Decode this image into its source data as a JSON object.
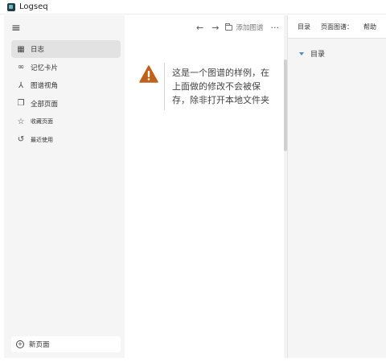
{
  "window": {
    "title": "Logseq"
  },
  "sidebar": {
    "menu_icon": "≡",
    "items": [
      {
        "icon": "calendar-icon",
        "glyph": "▦",
        "label": "日志",
        "active": true
      },
      {
        "icon": "flashcards-icon",
        "glyph": "∞",
        "label": "记忆卡片",
        "active": false
      },
      {
        "icon": "graph-icon",
        "glyph": "⅄",
        "label": "图谱视角",
        "active": false
      },
      {
        "icon": "pages-icon",
        "glyph": "❐",
        "label": "全部页面",
        "active": false
      },
      {
        "icon": "star-icon",
        "glyph": "☆",
        "label": "收藏页面",
        "active": false
      },
      {
        "icon": "history-icon",
        "glyph": "↺",
        "label": "最近使用",
        "active": false
      }
    ],
    "new_page_label": "新页面"
  },
  "toolbar": {
    "back_glyph": "←",
    "forward_glyph": "→",
    "add_graph_label": "添加图谱",
    "more_glyph": "···"
  },
  "main": {
    "warning_text": "这是一个图谱的样例，在上面做的修改不会被保存，除非打开本地文件夹",
    "warning_color": "#c0601a"
  },
  "right_panel": {
    "tabs": [
      "目录",
      "页面图谱：",
      "帮助"
    ],
    "toc_label": "目录",
    "accent": "#4a90c8"
  }
}
